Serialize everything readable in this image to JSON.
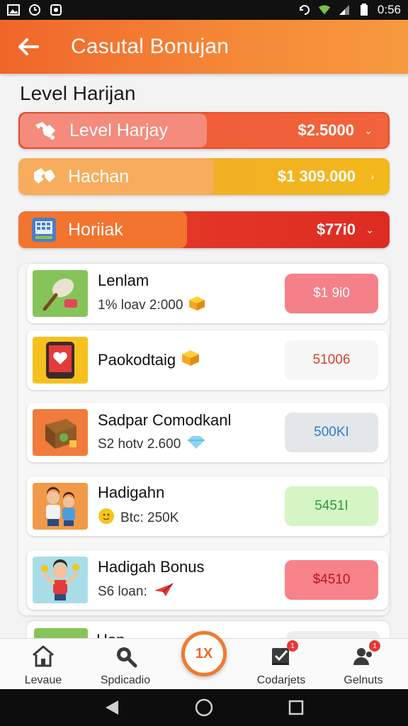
{
  "status_bar": {
    "time": "0:56"
  },
  "header": {
    "title": "Casutal Bonujan"
  },
  "section": {
    "title": "Level Harijan"
  },
  "levels": [
    {
      "label": "Level Harjay",
      "amount": "$2.5000",
      "icon": "handshake-icon"
    },
    {
      "label": "Hachan",
      "amount": "$1 309.000",
      "icon": "handshake-icon"
    },
    {
      "label": "Horiiak",
      "amount": "$77i0",
      "icon": "grid-icon"
    }
  ],
  "list": [
    {
      "name": "Lenlam",
      "sub": "1% loav 2:000",
      "button": "$1 9i0",
      "pill_color": "#f4818a",
      "text_color": "#ffffff"
    },
    {
      "name": "Paokodtaig",
      "sub": "",
      "button": "51006",
      "pill_color": "#f6f6f6",
      "text_color": "#d2462b"
    },
    {
      "name": "Sadpar Comodkanl",
      "sub": "S2 hotv 2.600",
      "button": "500KI",
      "pill_color": "#e4e7ea",
      "text_color": "#2a7fd0"
    },
    {
      "name": "Hadigahn",
      "sub": "Btc: 250K",
      "button": "5451I",
      "pill_color": "#d6f5c4",
      "text_color": "#2e9a3a"
    },
    {
      "name": "Hadigah Bonus",
      "sub": "S6 loan:",
      "button": "$4510",
      "pill_color": "#f7838a",
      "text_color": "#c0141e"
    }
  ],
  "partial_row": {
    "name": "Hon..."
  },
  "bottom_nav": [
    {
      "label": "Levaue",
      "icon": "home-icon"
    },
    {
      "label": "Spdicadio",
      "icon": "search-icon"
    },
    {
      "label": "Codarjets",
      "icon": "checklist-icon",
      "badge": "1"
    },
    {
      "label": "Gelnuts",
      "icon": "people-icon",
      "badge": "1"
    }
  ],
  "fab": {
    "label": "1X"
  },
  "colors": {
    "accent": "#f0662a",
    "appbar_end": "#f6993f"
  }
}
